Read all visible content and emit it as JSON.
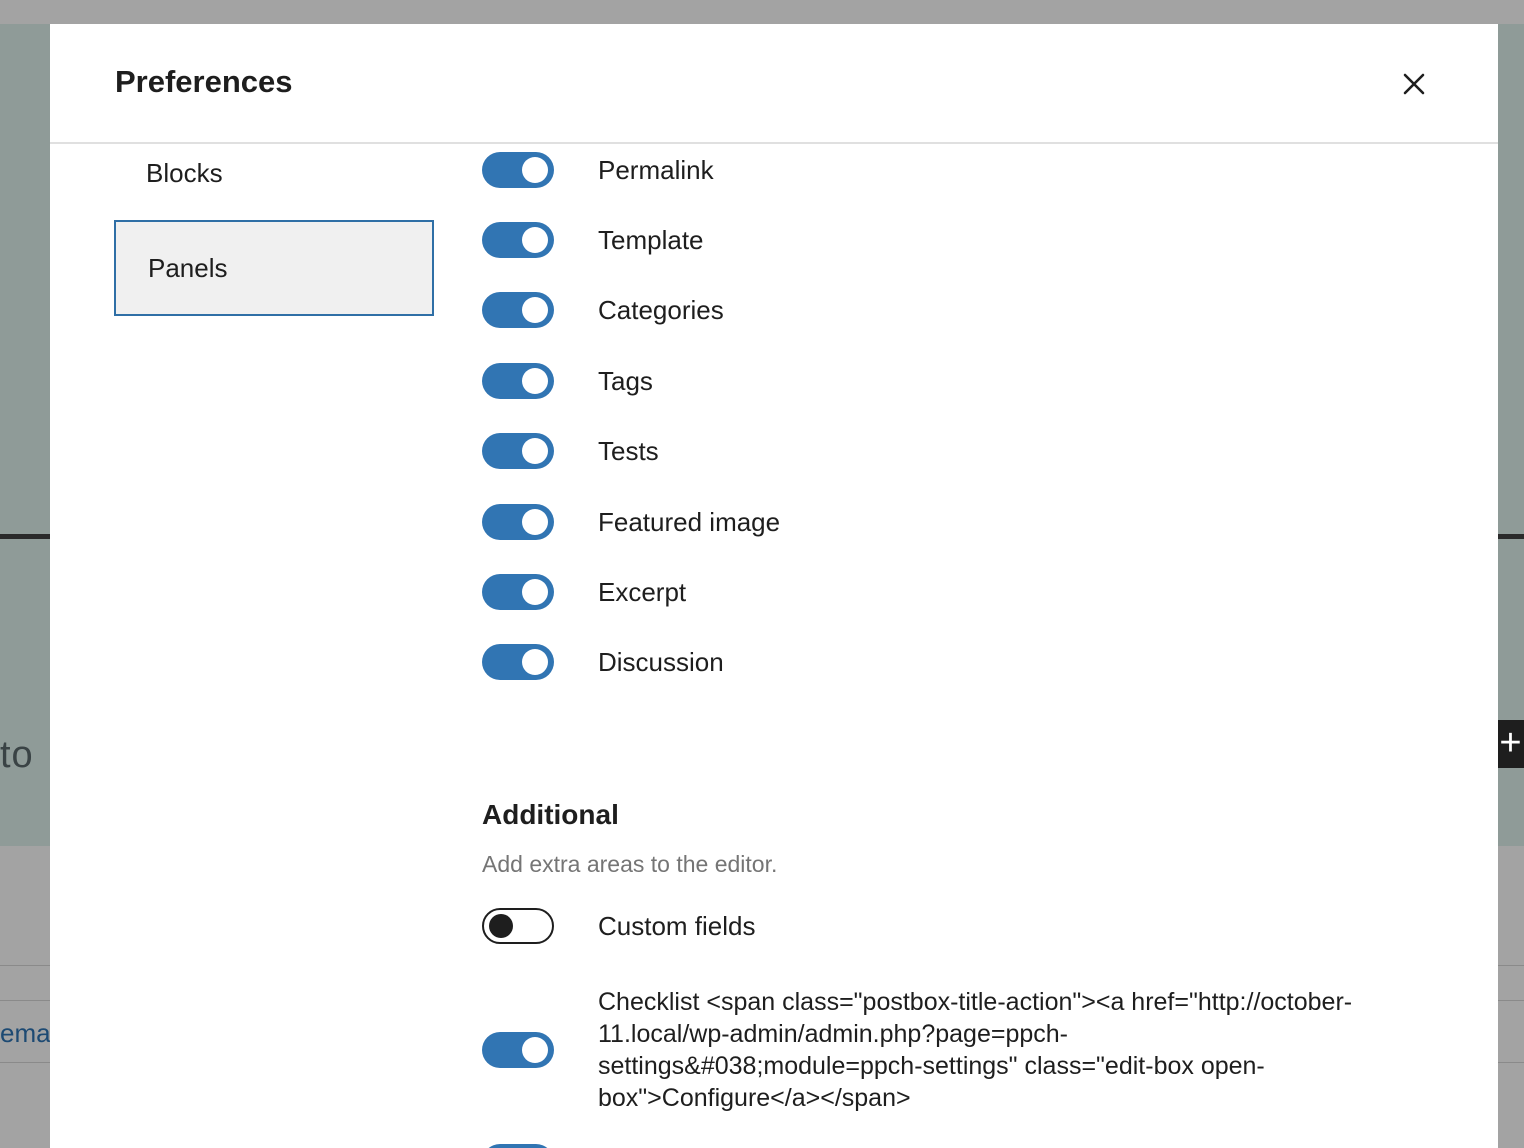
{
  "background": {
    "snippet_to": "to",
    "snippet_ema": "ema",
    "plus_symbol": "+"
  },
  "modal": {
    "title": "Preferences",
    "close_icon": "close-icon"
  },
  "sidebar": {
    "items": [
      {
        "label": "Blocks",
        "selected": false
      },
      {
        "label": "Panels",
        "selected": true
      }
    ]
  },
  "panels": {
    "toggles": [
      {
        "label": "Permalink",
        "enabled": true
      },
      {
        "label": "Template",
        "enabled": true
      },
      {
        "label": "Categories",
        "enabled": true
      },
      {
        "label": "Tags",
        "enabled": true
      },
      {
        "label": "Tests",
        "enabled": true
      },
      {
        "label": "Featured image",
        "enabled": true
      },
      {
        "label": "Excerpt",
        "enabled": true
      },
      {
        "label": "Discussion",
        "enabled": true
      }
    ]
  },
  "additional": {
    "title": "Additional",
    "description": "Add extra areas to the editor.",
    "toggles": [
      {
        "label": "Custom fields",
        "enabled": false
      },
      {
        "label": "Checklist <span class=\"postbox-title-action\"><a href=\"http://october-11.local/wp-admin/admin.php?page=ppch-settings&#038;module=ppch-settings\" class=\"edit-box open-box\">Configure</a></span>",
        "enabled": true
      }
    ]
  },
  "colors": {
    "accent": "#3175b3",
    "selected_border": "#2f6fa6",
    "overlay": "#8f9b98"
  }
}
